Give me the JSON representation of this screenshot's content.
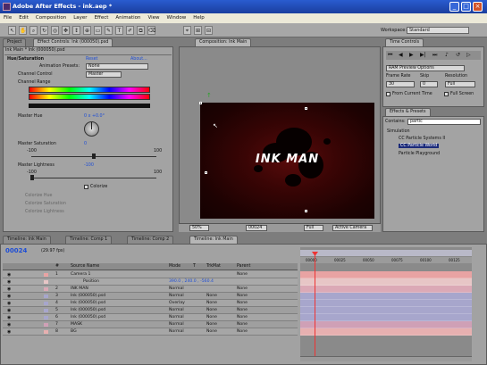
{
  "window": {
    "title": "Adobe After Effects - ink.aep *",
    "min": "_",
    "max": "□",
    "close": "×"
  },
  "menu": [
    "File",
    "Edit",
    "Composition",
    "Layer",
    "Effect",
    "Animation",
    "View",
    "Window",
    "Help"
  ],
  "toolbar": {
    "workspace_label": "Workspace:",
    "workspace_value": "Standard"
  },
  "left_panel": {
    "tabs": [
      "Project",
      "Effect Controls: Ink (000050).psd"
    ],
    "header": "Ink Main * Ink (000050).psd",
    "effect_name": "Hue/Saturation",
    "reset": "Reset",
    "about": "About...",
    "animation_presets_label": "Animation Presets:",
    "animation_presets_value": "None",
    "channel_control_label": "Channel Control",
    "channel_control_value": "Master",
    "channel_range_label": "Channel Range",
    "master_hue_label": "Master Hue",
    "master_hue_value": "0 x +0.0°",
    "master_saturation_label": "Master Saturation",
    "master_saturation_value": "0",
    "sat_min": "-100",
    "sat_max": "100",
    "master_lightness_label": "Master Lightness",
    "master_lightness_value": "-100",
    "light_min": "-100",
    "light_max": "100",
    "colorize_label": "Colorize",
    "colorize_hue_label": "Colorize Hue",
    "colorize_saturation_label": "Colorize Saturation",
    "colorize_lightness_label": "Colorize Lightness"
  },
  "comp_panel": {
    "tab": "Composition: Ink Main",
    "title_text": "INK MAN",
    "zoom": "50%",
    "timecode": "00024",
    "resolution": "Full",
    "view": "Active Camera"
  },
  "time_controls": {
    "tab": "Time Controls",
    "ram_preview": "RAM Preview Options",
    "frame_rate_label": "Frame Rate",
    "frame_rate_value": "30",
    "skip_label": "Skip",
    "skip_value": "0",
    "resolution_label": "Resolution",
    "resolution_value": "Full",
    "from_current": "From Current Time",
    "full_screen": "Full Screen"
  },
  "effects_presets": {
    "tab": "Effects & Presets",
    "contains_label": "Contains:",
    "contains_value": "partic",
    "category": "Simulation",
    "items": [
      "CC Particle Systems II",
      "CC Particle World",
      "Particle Playground"
    ]
  },
  "timeline": {
    "tabs": [
      "Timeline: Ink Main",
      "Timeline: Comp 1",
      "Timeline: Comp 2",
      "Timeline: Ink Main"
    ],
    "timecode": "00024",
    "fps_note": "(29.97 fps)",
    "columns": [
      "#",
      "Source Name",
      "Mode",
      "T",
      "TrkMat",
      "Parent"
    ],
    "layers": [
      {
        "num": "1",
        "name": "Camera 1",
        "mode": "",
        "trkmat": "",
        "parent": "None",
        "color": "#e8a3a3"
      },
      {
        "num": "",
        "name": "Position",
        "mode": "390.0 , 240.0 , -560.4",
        "trkmat": "",
        "parent": "",
        "color": "#e7c6c6"
      },
      {
        "num": "2",
        "name": "INK MAN",
        "mode": "Normal",
        "trkmat": "",
        "parent": "None",
        "color": "#dba9b6"
      },
      {
        "num": "3",
        "name": "Ink (000050).psd",
        "mode": "Normal",
        "trkmat": "None",
        "parent": "None",
        "color": "#a7a6cc"
      },
      {
        "num": "4",
        "name": "Ink (000050).psd",
        "mode": "Overlay",
        "trkmat": "None",
        "parent": "None",
        "color": "#a7a6cc"
      },
      {
        "num": "5",
        "name": "Ink (000050).psd",
        "mode": "Normal",
        "trkmat": "None",
        "parent": "None",
        "color": "#a7a6cc"
      },
      {
        "num": "6",
        "name": "Ink (000050).psd",
        "mode": "Normal",
        "trkmat": "None",
        "parent": "None",
        "color": "#a7a6cc"
      },
      {
        "num": "7",
        "name": "MASK",
        "mode": "Normal",
        "trkmat": "None",
        "parent": "None",
        "color": "#cfa0b6"
      },
      {
        "num": "8",
        "name": "BG",
        "mode": "Normal",
        "trkmat": "None",
        "parent": "None",
        "color": "#e7b0b0"
      }
    ],
    "ruler": [
      "00000",
      "00025",
      "00050",
      "00075",
      "00100",
      "00125"
    ]
  }
}
